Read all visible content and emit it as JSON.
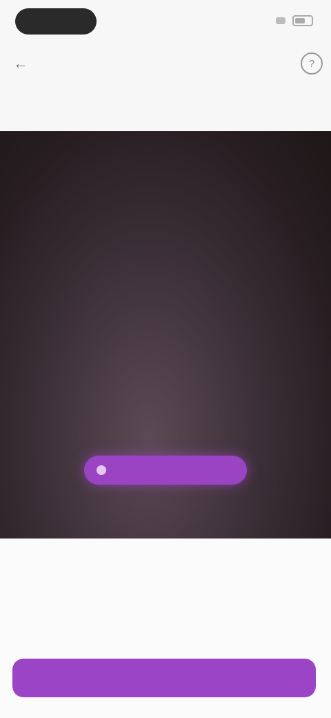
{
  "status_bar": {
    "time": "",
    "signal_icon": "signal-icon",
    "battery_icon": "battery-icon"
  },
  "app_bar": {
    "back_icon": "arrow-left-icon",
    "title": "",
    "help_icon": "help-icon"
  },
  "subheading": "",
  "viewfinder": {
    "detect_chip_label": ""
  },
  "card": {
    "title": "",
    "description": "",
    "primary_button": ""
  },
  "colors": {
    "accent": "#9b45c6",
    "viewfinder_bg": "#2e2327"
  }
}
